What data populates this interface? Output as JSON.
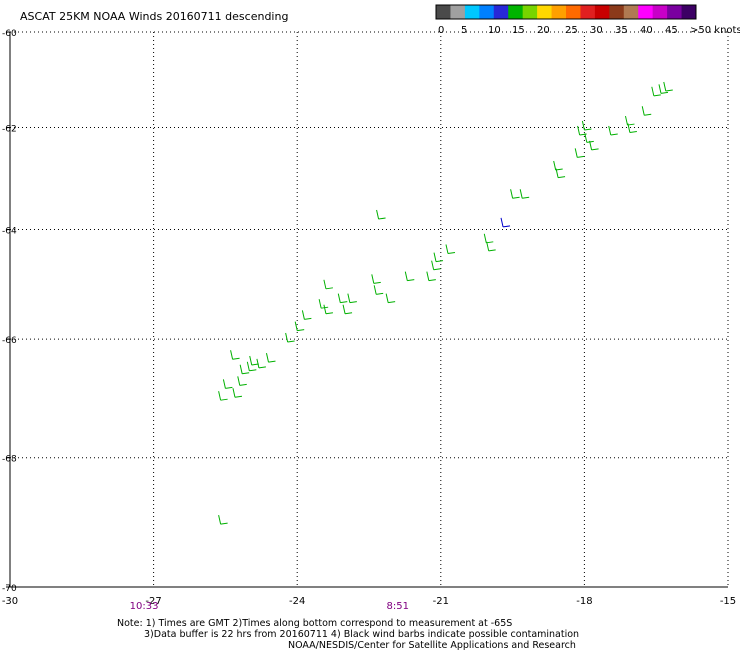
{
  "chart_data": {
    "type": "scatter",
    "title": "ASCAT 25KM NOAA Winds 20160711 descending",
    "xlim": [
      -30,
      -15
    ],
    "ylim": [
      -70,
      -60
    ],
    "x_ticks": [
      -30,
      -27,
      -24,
      -21,
      -18,
      -15
    ],
    "y_ticks": [
      -60,
      -62,
      -64,
      -66,
      -68,
      -70
    ],
    "grid": "dotted",
    "legend": {
      "placement": "top-right",
      "labels": [
        "0",
        "5",
        "10",
        "15",
        "20",
        "25",
        "30",
        "35",
        "40",
        "45",
        ">50 knots"
      ],
      "colors": [
        "#4a4a4a",
        "#a0a0a0",
        "#00c8ff",
        "#0080ff",
        "#2828d8",
        "#00b400",
        "#78d400",
        "#ffd800",
        "#ffa000",
        "#ff6a00",
        "#e02020",
        "#c80000",
        "#8b3a1a",
        "#b07a52",
        "#ff00ff",
        "#c800c8",
        "#7a00a0",
        "#3c0064"
      ]
    },
    "time_labels": [
      {
        "text": "10:33",
        "x": -27.2
      },
      {
        "text": "8:51",
        "x": -21.9
      }
    ],
    "time_color": "#800080",
    "notes": [
      "Note: 1) Times are GMT 2)Times along bottom correspond to measurement at -65S",
      "3)Data buffer is 22 hrs from 20160711 4) Black wind barbs indicate possible contamination",
      "NOAA/NESDIS/Center for Satellite Applications and Research"
    ],
    "series": [
      {
        "color": "#00b000",
        "points": [
          [
            -16.55,
            -61.35
          ],
          [
            -16.4,
            -61.3
          ],
          [
            -16.3,
            -61.25
          ],
          [
            -16.75,
            -61.75
          ],
          [
            -17.1,
            -61.95
          ],
          [
            -17.05,
            -62.1
          ],
          [
            -17.45,
            -62.15
          ],
          [
            -18.0,
            -62.05
          ],
          [
            -18.1,
            -62.15
          ],
          [
            -17.95,
            -62.3
          ],
          [
            -17.85,
            -62.45
          ],
          [
            -18.15,
            -62.6
          ],
          [
            -18.6,
            -62.85
          ],
          [
            -18.55,
            -63.0
          ],
          [
            -19.3,
            -63.4
          ],
          [
            -19.5,
            -63.4
          ],
          [
            -20.05,
            -64.25
          ],
          [
            -20.0,
            -64.4
          ],
          [
            -21.1,
            -64.6
          ],
          [
            -20.85,
            -64.45
          ],
          [
            -21.15,
            -64.75
          ],
          [
            -21.25,
            -64.95
          ],
          [
            -21.7,
            -64.95
          ],
          [
            -22.3,
            -63.8
          ],
          [
            -22.4,
            -65.0
          ],
          [
            -22.35,
            -65.2
          ],
          [
            -22.1,
            -65.35
          ],
          [
            -22.9,
            -65.35
          ],
          [
            -23.1,
            -65.35
          ],
          [
            -23.0,
            -65.55
          ],
          [
            -23.4,
            -65.55
          ],
          [
            -23.4,
            -65.1
          ],
          [
            -23.5,
            -65.45
          ],
          [
            -23.85,
            -65.65
          ],
          [
            -24.0,
            -65.85
          ],
          [
            -24.6,
            -66.4
          ],
          [
            -24.8,
            -66.5
          ],
          [
            -24.95,
            -66.45
          ],
          [
            -25.15,
            -66.6
          ],
          [
            -25.2,
            -66.8
          ],
          [
            -25.35,
            -66.35
          ],
          [
            -25.0,
            -66.55
          ],
          [
            -25.3,
            -67.0
          ],
          [
            -25.5,
            -66.85
          ],
          [
            -25.6,
            -67.05
          ],
          [
            -24.2,
            -66.05
          ],
          [
            -25.6,
            -69.05
          ]
        ]
      },
      {
        "color": "#0000cc",
        "points": [
          [
            -19.7,
            -63.95
          ]
        ]
      }
    ]
  }
}
